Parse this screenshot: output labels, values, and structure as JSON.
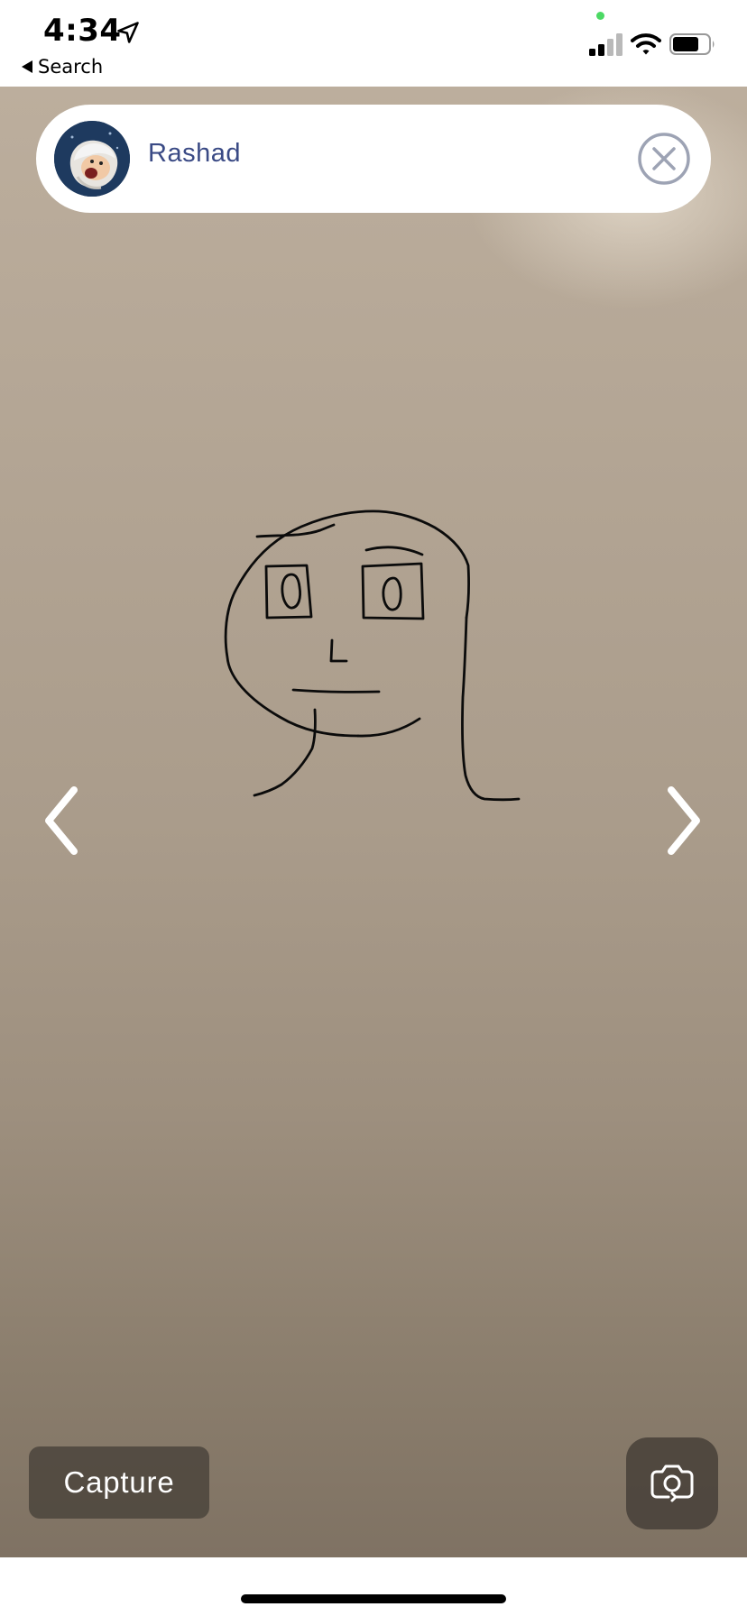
{
  "status_bar": {
    "time": "4:34",
    "back_label": "Search",
    "icons": [
      "location-arrow-icon",
      "signal-icon",
      "wifi-icon",
      "battery-icon"
    ]
  },
  "header": {
    "username": "Rashad",
    "avatar_icon": "cartoon-avatar",
    "close_icon": "close-circle-icon"
  },
  "navigation": {
    "prev_icon": "chevron-left-icon",
    "next_icon": "chevron-right-icon"
  },
  "actions": {
    "capture_label": "Capture",
    "flip_camera_icon": "camera-flip-icon"
  },
  "colors": {
    "accent_text": "#3a4a85",
    "button_bg": "#464038"
  }
}
